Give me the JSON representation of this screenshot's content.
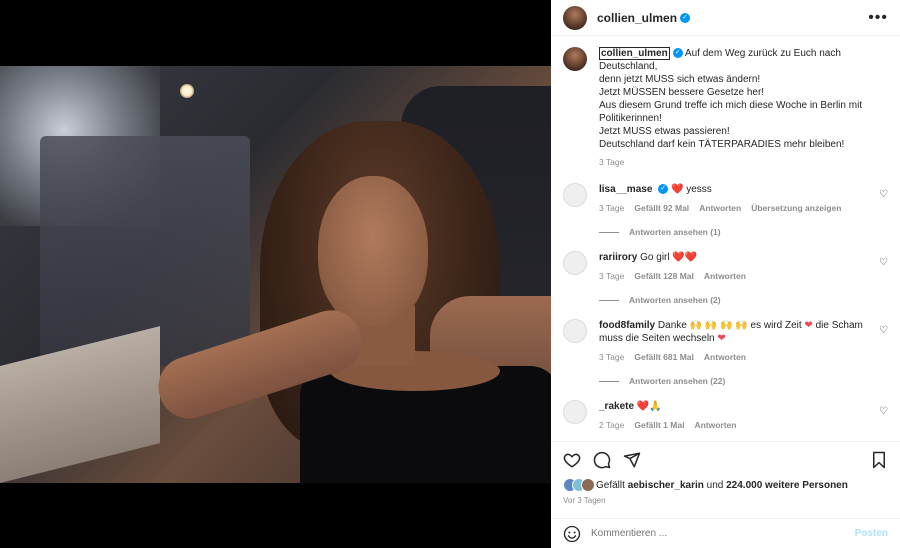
{
  "post": {
    "username": "collien_ulmen",
    "caption_lines": [
      "Auf dem Weg zurück zu Euch nach Deutschland,",
      "denn jetzt MUSS sich etwas ändern!",
      "Jetzt MÜSSEN bessere Gesetze her!",
      "Aus diesem Grund treffe ich mich diese Woche in Berlin mit Politikerinnen!",
      "Jetzt MUSS etwas passieren!",
      "Deutschland darf kein TÄTERPARADIES mehr bleiben!"
    ],
    "caption_time": "3 Tage"
  },
  "comments": [
    {
      "user": "lisa__mase",
      "verified": true,
      "text": "yesss",
      "emoji": "❤️",
      "time": "3 Tage",
      "likes": "Gefällt 92 Mal",
      "reply": "Antworten",
      "translate": "Übersetzung anzeigen",
      "view_replies": "Antworten ansehen (1)"
    },
    {
      "user": "rariirory",
      "text": "Go girl",
      "emoji": "❤️❤️",
      "time": "3 Tage",
      "likes": "Gefällt 128 Mal",
      "reply": "Antworten",
      "view_replies": "Antworten ansehen (2)"
    },
    {
      "user": "food8family",
      "text_a": "Danke",
      "hands": "🙌 🙌 🙌 🙌",
      "text_b": "es wird Zeit",
      "text_c": "die Scham muss die Seiten wechseln",
      "time": "3 Tage",
      "likes": "Gefällt 681 Mal",
      "reply": "Antworten",
      "view_replies": "Antworten ansehen (22)"
    },
    {
      "user": "_rakete",
      "emoji": "❤️🙏",
      "time": "2 Tage",
      "likes": "Gefällt 1 Mal",
      "reply": "Antworten"
    }
  ],
  "likes_bar": {
    "prefix": "Gefällt",
    "user": "aebischer_karin",
    "middle": "und",
    "count": "224.000 weitere Personen"
  },
  "posted": "Vor 3 Tagen",
  "comment_box": {
    "placeholder": "Kommentieren ...",
    "post_label": "Posten"
  },
  "icons": {
    "more": "•••",
    "verified": "✓",
    "heart_outline": "♡",
    "heart_filled": "❤"
  }
}
